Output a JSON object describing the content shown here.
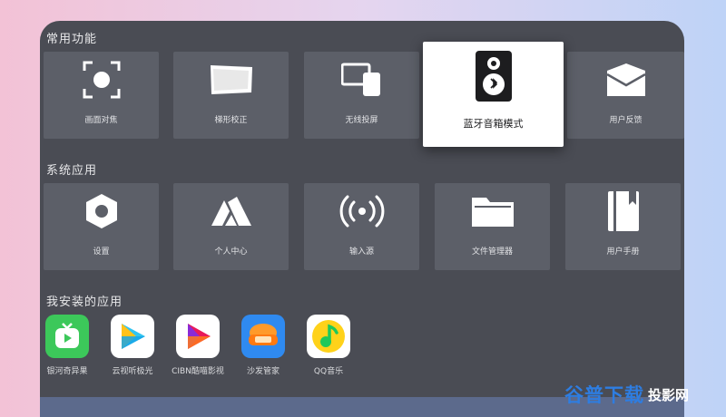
{
  "sections": {
    "common": {
      "title": "常用功能",
      "tiles": [
        {
          "label": "画面对焦",
          "icon": "focus-icon"
        },
        {
          "label": "梯形校正",
          "icon": "keystone-icon"
        },
        {
          "label": "无线投屏",
          "icon": "screen-cast-icon"
        },
        {
          "label": "蓝牙音箱模式",
          "icon": "bluetooth-speaker-icon",
          "focused": true
        },
        {
          "label": "用户反馈",
          "icon": "feedback-mail-icon"
        }
      ]
    },
    "system": {
      "title": "系统应用",
      "tiles": [
        {
          "label": "设置",
          "icon": "settings-hex-icon"
        },
        {
          "label": "个人中心",
          "icon": "user-center-icon"
        },
        {
          "label": "输入源",
          "icon": "input-source-icon"
        },
        {
          "label": "文件管理器",
          "icon": "folder-icon"
        },
        {
          "label": "用户手册",
          "icon": "manual-book-icon"
        }
      ]
    },
    "installed": {
      "title": "我安装的应用",
      "apps": [
        {
          "label": "银河奇异果",
          "icon": "yinhe-qiyiguo-icon",
          "color": "#3cc85a"
        },
        {
          "label": "云视听极光",
          "icon": "yunshiting-jiguang-icon",
          "color": "#ffffff"
        },
        {
          "label": "CIBN酷喵影视",
          "icon": "cibn-kumiao-icon",
          "color": "#ffffff"
        },
        {
          "label": "沙发管家",
          "icon": "sofa-butler-icon",
          "color": "#2f8af0"
        },
        {
          "label": "QQ音乐",
          "icon": "qq-music-icon",
          "color": "#ffffff"
        }
      ]
    }
  },
  "watermark": {
    "text": "谷普下载",
    "text2": "投影网"
  },
  "colors": {
    "panel": "#4a4c54",
    "tile": "#5c5f68",
    "focus": "#ffffff"
  }
}
